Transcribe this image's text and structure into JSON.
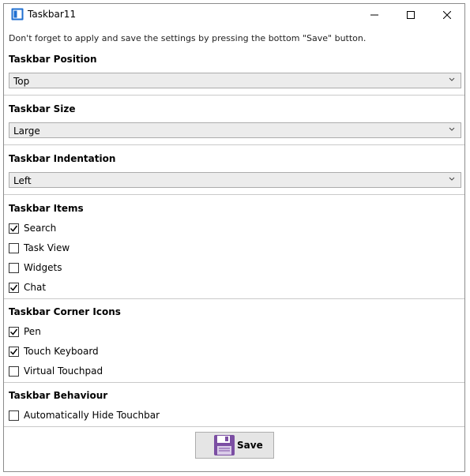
{
  "window": {
    "title": "Taskbar11"
  },
  "notice": "Don't forget to apply and save the settings by pressing the bottom \"Save\" button.",
  "position": {
    "title": "Taskbar Position",
    "value": "Top"
  },
  "size": {
    "title": "Taskbar Size",
    "value": "Large"
  },
  "indentation": {
    "title": "Taskbar Indentation",
    "value": "Left"
  },
  "items": {
    "title": "Taskbar Items",
    "options": [
      {
        "label": "Search",
        "checked": true
      },
      {
        "label": "Task View",
        "checked": false
      },
      {
        "label": "Widgets",
        "checked": false
      },
      {
        "label": "Chat",
        "checked": true
      }
    ]
  },
  "corner": {
    "title": "Taskbar Corner Icons",
    "options": [
      {
        "label": "Pen",
        "checked": true
      },
      {
        "label": "Touch Keyboard",
        "checked": true
      },
      {
        "label": "Virtual Touchpad",
        "checked": false
      }
    ]
  },
  "behaviour": {
    "title": "Taskbar Behaviour",
    "options": [
      {
        "label": "Automatically Hide Touchbar",
        "checked": false
      }
    ]
  },
  "save": {
    "label": "Save"
  },
  "colors": {
    "icon_blue": "#1f6fd1",
    "floppy_purple": "#7b4ea3"
  }
}
